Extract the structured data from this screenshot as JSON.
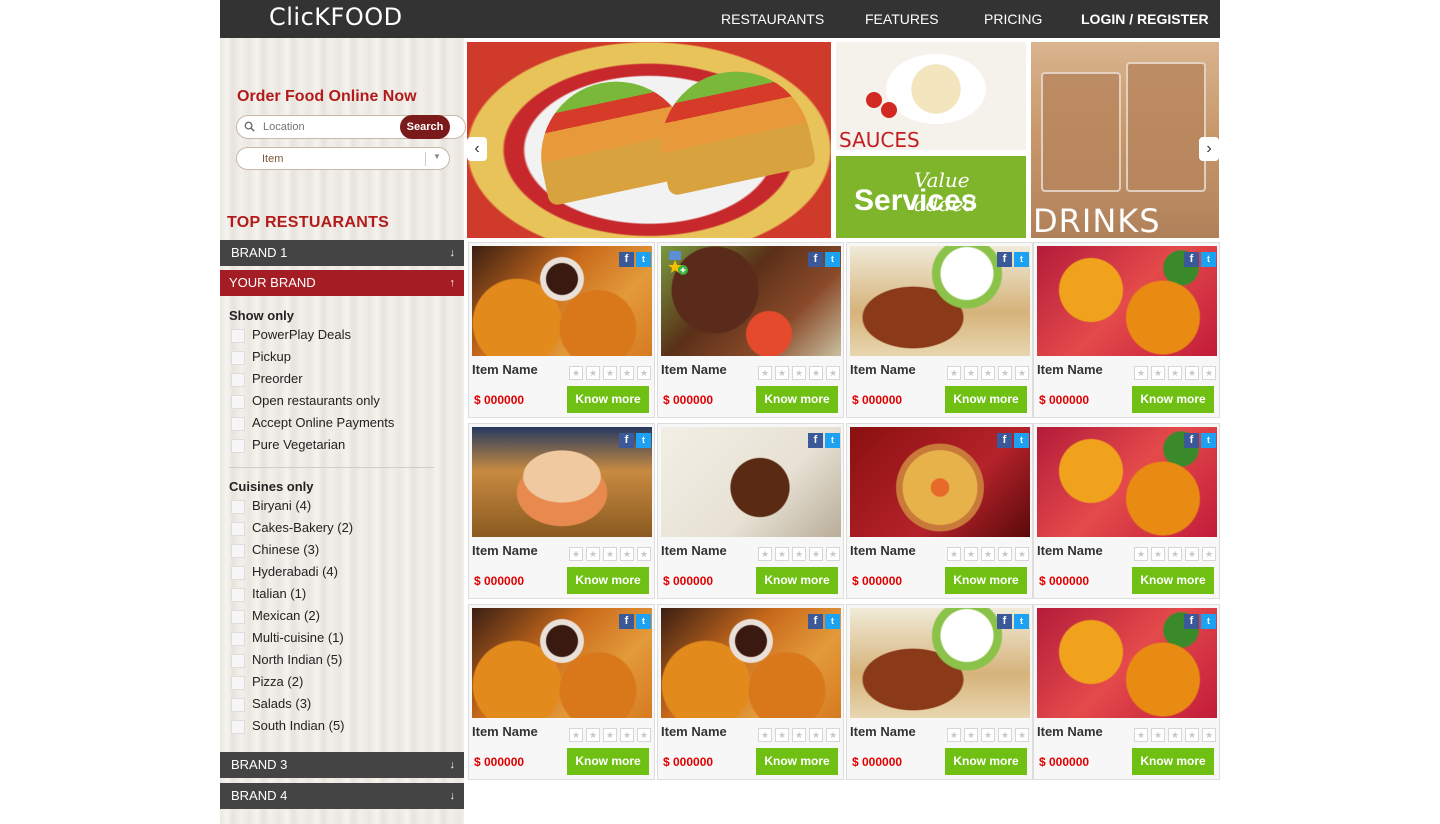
{
  "header": {
    "logo": "ClicKFOOD",
    "nav": [
      "RESTAURANTS",
      "FEATURES",
      "PRICING",
      "LOGIN / REGISTER"
    ]
  },
  "sidebar": {
    "order_title": "Order Food Online Now",
    "search_placeholder": "Location",
    "search_button": "Search",
    "item_select": "Item",
    "top_title": "TOP RESTUARANTS",
    "brands": [
      {
        "label": "BRAND 1",
        "icon": "arrow-down-icon",
        "arrow": "↓"
      },
      {
        "label": "YOUR BRAND",
        "icon": "arrow-up-icon",
        "arrow": "↑"
      },
      {
        "label": "BRAND 3",
        "icon": "arrow-down-icon",
        "arrow": "↓"
      },
      {
        "label": "BRAND 4",
        "icon": "arrow-down-icon",
        "arrow": "↓"
      }
    ],
    "show_only_title": "Show only",
    "show_only": [
      "PowerPlay Deals",
      "Pickup",
      "Preorder",
      "Open restaurants only",
      "Accept Online Payments",
      "Pure Vegetarian"
    ],
    "cuisines_title": "Cuisines only",
    "cuisines": [
      "Biryani (4)",
      "Cakes-Bakery (2)",
      "Chinese (3)",
      "Hyderabadi (4)",
      "Italian (1)",
      "Mexican (2)",
      "Multi-cuisine (1)",
      "North Indian (5)",
      "Pizza (2)",
      "Salads (3)",
      "South Indian (5)"
    ]
  },
  "banner": {
    "prev": "‹",
    "next": "›",
    "sauces": "SAUCES",
    "value_added": "Value added",
    "services": "Services",
    "drinks": "DRINKS"
  },
  "colors": {
    "accent_red": "#b31b1b",
    "active_brand": "#a51d24",
    "know_more_green": "#6fc013",
    "price_red": "#e00000",
    "nav_bg": "#333333"
  },
  "products": [
    {
      "name": "Item Name",
      "price": "$ 000000",
      "button": "Know more",
      "photo": "chicken",
      "fb": "f",
      "tw": "t"
    },
    {
      "name": "Item Name",
      "price": "$ 000000",
      "button": "Know more",
      "photo": "steak",
      "fb": "f",
      "tw": "t"
    },
    {
      "name": "Item Name",
      "price": "$ 000000",
      "button": "Know more",
      "photo": "kebab",
      "fb": "f",
      "tw": "t"
    },
    {
      "name": "Item Name",
      "price": "$ 000000",
      "button": "Know more",
      "photo": "taco",
      "fb": "f",
      "tw": "t"
    },
    {
      "name": "Item Name",
      "price": "$ 000000",
      "button": "Know more",
      "photo": "sandwich",
      "fb": "f",
      "tw": "t"
    },
    {
      "name": "Item Name",
      "price": "$ 000000",
      "button": "Know more",
      "photo": "rice",
      "fb": "f",
      "tw": "t"
    },
    {
      "name": "Item Name",
      "price": "$ 000000",
      "button": "Know more",
      "photo": "pizza",
      "fb": "f",
      "tw": "t"
    },
    {
      "name": "Item Name",
      "price": "$ 000000",
      "button": "Know more",
      "photo": "taco",
      "fb": "f",
      "tw": "t"
    },
    {
      "name": "Item Name",
      "price": "$ 000000",
      "button": "Know more",
      "photo": "chicken",
      "fb": "f",
      "tw": "t"
    },
    {
      "name": "Item Name",
      "price": "$ 000000",
      "button": "Know more",
      "photo": "chicken",
      "fb": "f",
      "tw": "t"
    },
    {
      "name": "Item Name",
      "price": "$ 000000",
      "button": "Know more",
      "photo": "kebab",
      "fb": "f",
      "tw": "t"
    },
    {
      "name": "Item Name",
      "price": "$ 000000",
      "button": "Know more",
      "photo": "taco",
      "fb": "f",
      "tw": "t"
    }
  ]
}
